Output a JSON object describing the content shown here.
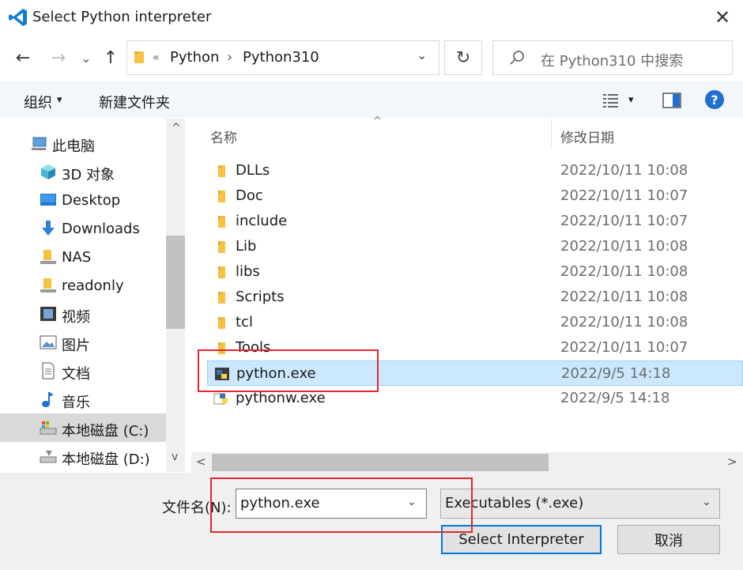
{
  "window": {
    "title": "Select Python interpreter",
    "close_glyph": "✕"
  },
  "nav": {
    "back_glyph": "←",
    "forward_glyph": "→",
    "recent_glyph": "⌄",
    "up_glyph": "↑",
    "breadcrumb_sep": "«",
    "breadcrumb": [
      "Python",
      "Python310"
    ],
    "crumb_arrow": "›",
    "dropdown_glyph": "⌄",
    "refresh_glyph": "↻"
  },
  "search": {
    "placeholder": "在 Python310 中搜索"
  },
  "toolbar": {
    "organize_label": "组织",
    "organize_caret": "▾",
    "new_folder_label": "新建文件夹",
    "view_caret": "▾",
    "help_glyph": "?"
  },
  "sidebar": {
    "items": [
      {
        "label": "此电脑",
        "icon": "computer-icon"
      },
      {
        "label": "3D 对象",
        "icon": "cube-3d-icon"
      },
      {
        "label": "Desktop",
        "icon": "desktop-icon"
      },
      {
        "label": "Downloads",
        "icon": "download-icon"
      },
      {
        "label": "NAS",
        "icon": "network-drive-icon"
      },
      {
        "label": "readonly",
        "icon": "network-drive-icon"
      },
      {
        "label": "视频",
        "icon": "video-icon"
      },
      {
        "label": "图片",
        "icon": "picture-icon"
      },
      {
        "label": "文档",
        "icon": "document-icon"
      },
      {
        "label": "音乐",
        "icon": "music-icon"
      },
      {
        "label": "本地磁盘 (C:)",
        "icon": "local-disk-icon",
        "selected": true
      },
      {
        "label": "本地磁盘 (D:)",
        "icon": "local-disk-icon"
      }
    ]
  },
  "files": {
    "col_name": "名称",
    "col_date": "修改日期",
    "sort_glyph": "^",
    "rows": [
      {
        "name": "DLLs",
        "date": "2022/10/11 10:08",
        "type": "folder"
      },
      {
        "name": "Doc",
        "date": "2022/10/11 10:07",
        "type": "folder"
      },
      {
        "name": "include",
        "date": "2022/10/11 10:07",
        "type": "folder"
      },
      {
        "name": "Lib",
        "date": "2022/10/11 10:08",
        "type": "folder"
      },
      {
        "name": "libs",
        "date": "2022/10/11 10:08",
        "type": "folder"
      },
      {
        "name": "Scripts",
        "date": "2022/10/11 10:08",
        "type": "folder"
      },
      {
        "name": "tcl",
        "date": "2022/10/11 10:08",
        "type": "folder"
      },
      {
        "name": "Tools",
        "date": "2022/10/11 10:07",
        "type": "folder"
      },
      {
        "name": "python.exe",
        "date": "2022/9/5 14:18",
        "type": "python",
        "selected": true
      },
      {
        "name": "pythonw.exe",
        "date": "2022/9/5 14:18",
        "type": "pythonw"
      }
    ]
  },
  "scroll": {
    "left_glyph": "<",
    "right_glyph": ">",
    "up_glyph": "^",
    "down_glyph": "v"
  },
  "footer": {
    "filename_label": "文件名(N):",
    "filename_value": "python.exe",
    "filetype_value": "Executables (*.exe)",
    "dropdown_glyph": "⌄",
    "ok_label": "Select Interpreter",
    "cancel_label": "取消"
  },
  "colors": {
    "accent": "#0078d7",
    "selection": "#cce8ff",
    "highlight_box": "#e3262c",
    "folder": "#f5c242"
  }
}
